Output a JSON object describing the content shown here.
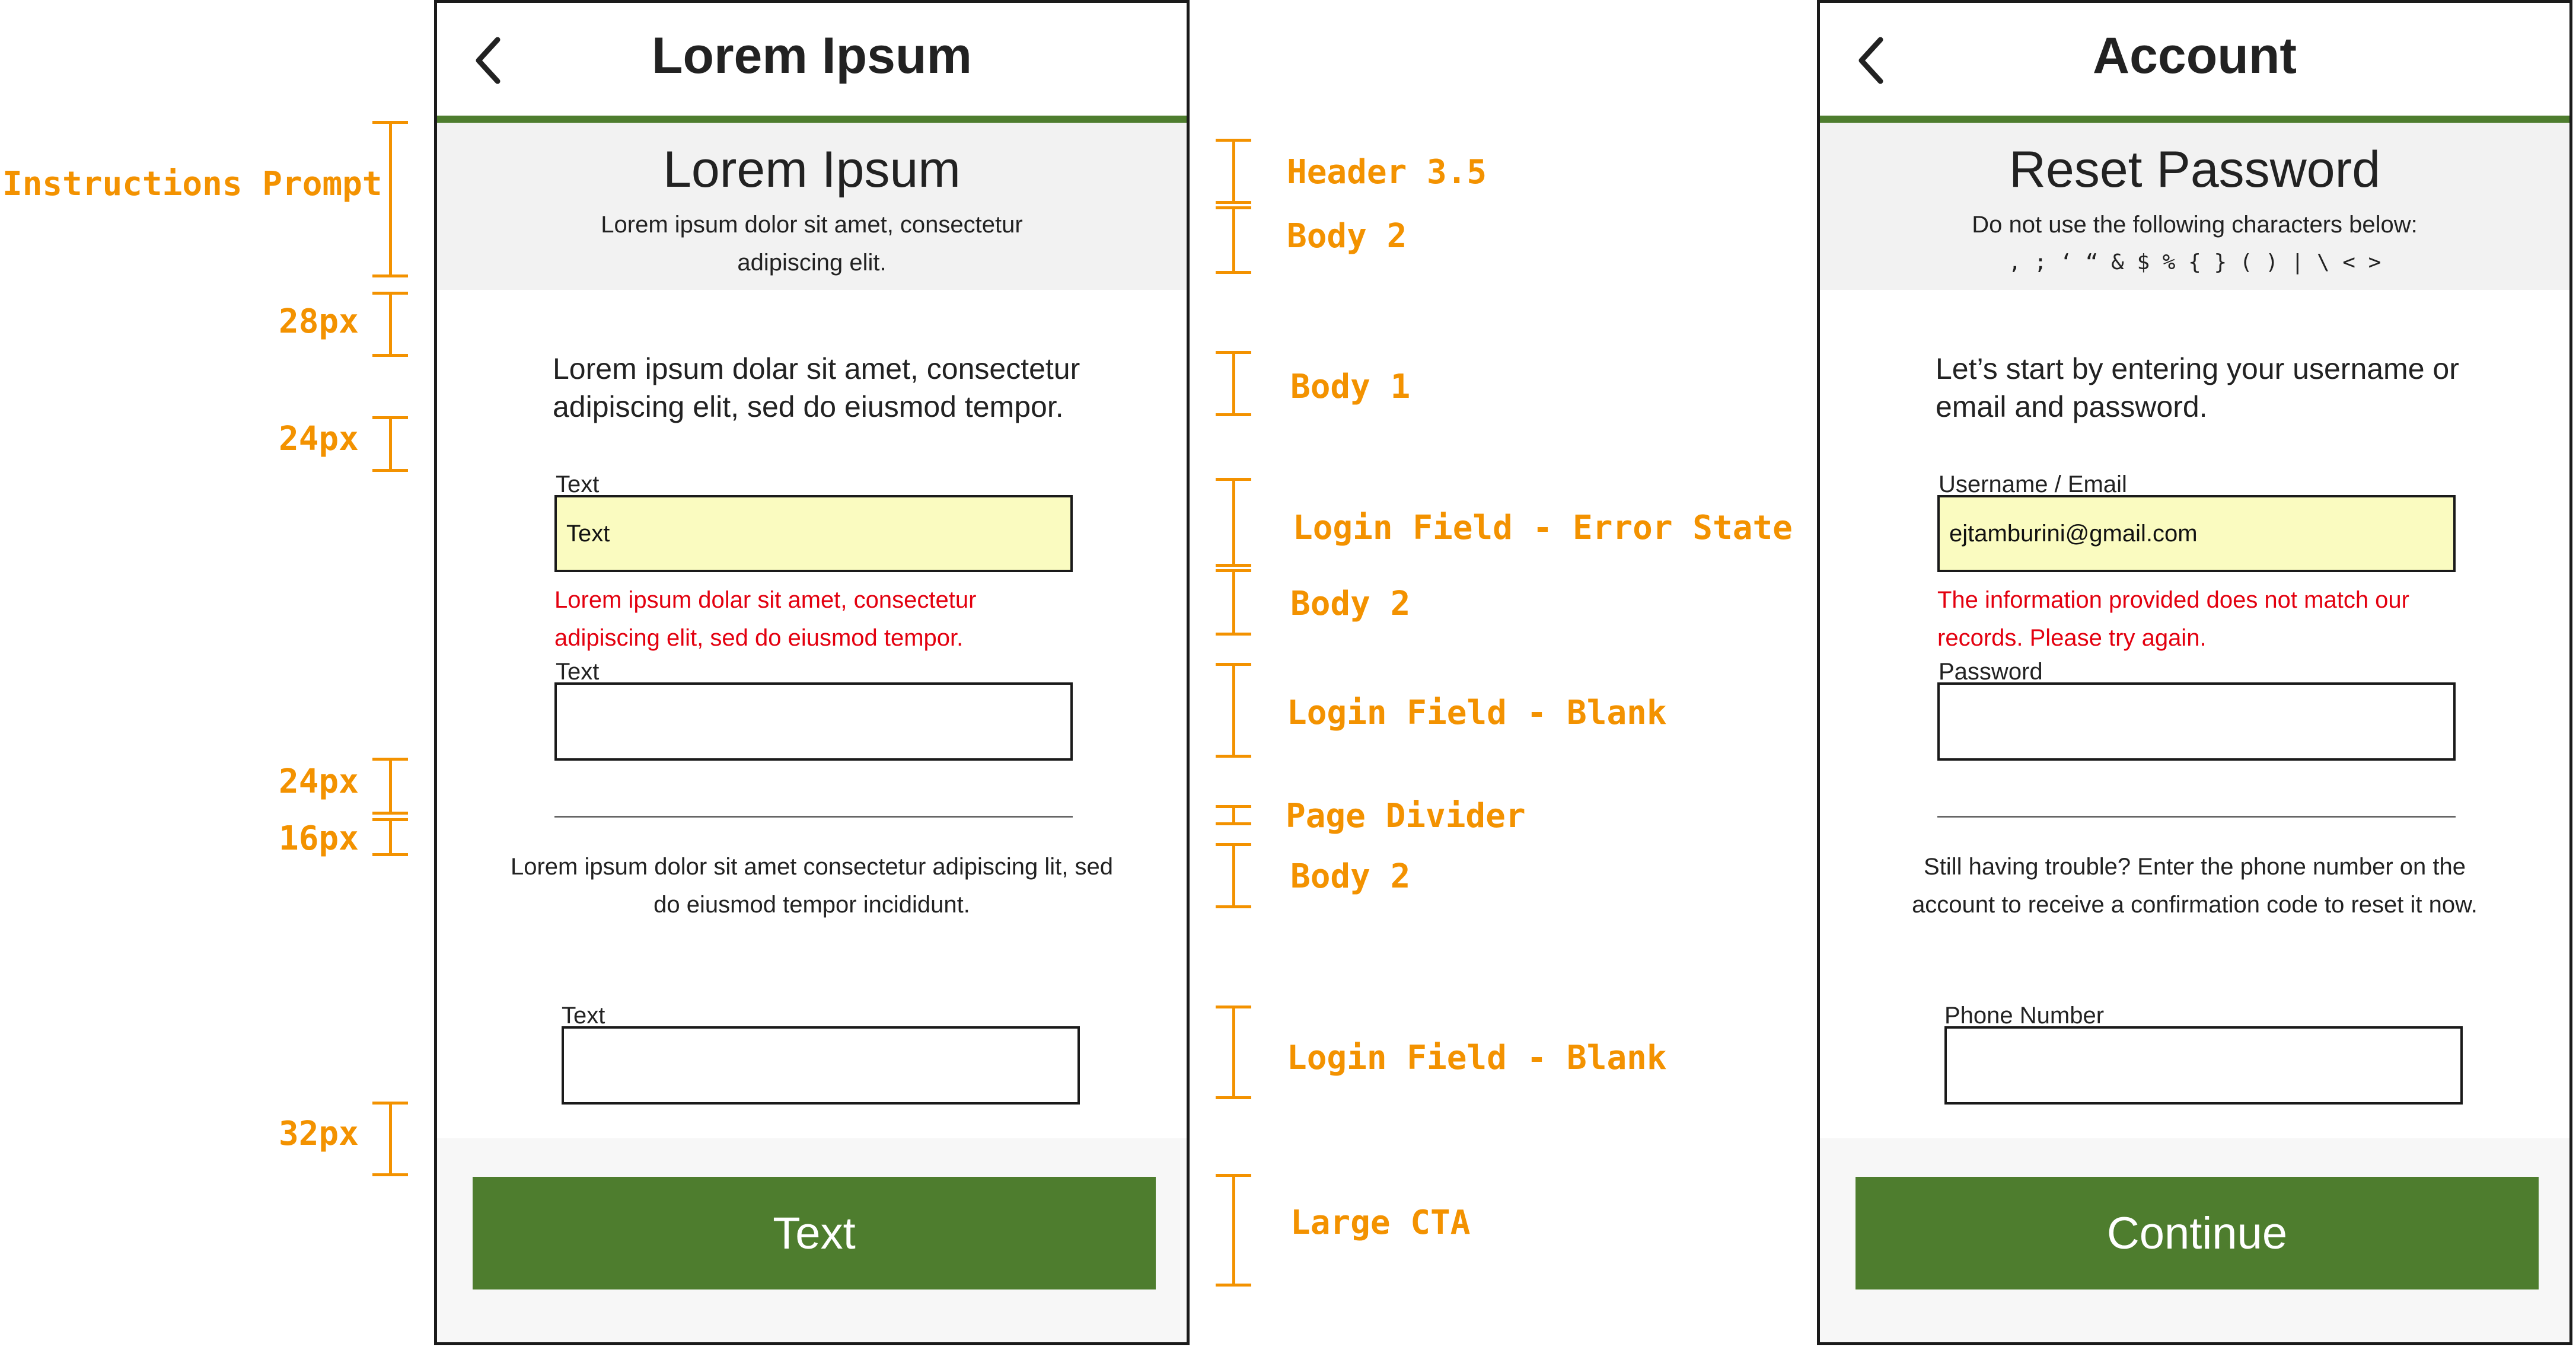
{
  "left_annotations": {
    "instructions_prompt": "Instructions Prompt",
    "spacing_28": "28px",
    "spacing_24a": "24px",
    "spacing_24b": "24px",
    "spacing_16": "16px",
    "spacing_32": "32px"
  },
  "middle_annotations": {
    "header_35": "Header 3.5",
    "body2_a": "Body 2",
    "body1": "Body 1",
    "login_error": "Login Field - Error State",
    "body2_b": "Body 2",
    "login_blank_a": "Login Field - Blank",
    "page_divider": "Page Divider",
    "body2_c": "Body 2",
    "login_blank_b": "Login Field - Blank",
    "large_cta": "Large CTA"
  },
  "template_screen": {
    "nav_title": "Lorem Ipsum",
    "prompt_header": "Lorem Ipsum",
    "prompt_body": "Lorem ipsum dolor sit amet, consectetur adipiscing elit.",
    "intro": "Lorem ipsum dolar sit amet, consectetur adipiscing elit, sed do eiusmod tempor.",
    "field1_label": "Text",
    "field1_value": "Text",
    "error_message": "Lorem ipsum dolar sit amet, consectetur adipiscing elit, sed do eiusmod tempor.",
    "field2_label": "Text",
    "field2_value": "",
    "body2_text": "Lorem ipsum dolor sit amet consectetur adipiscing lit, sed do eiusmod tempor incididunt.",
    "field3_label": "Text",
    "field3_value": "",
    "cta_label": "Text"
  },
  "account_screen": {
    "nav_title": "Account",
    "prompt_header": "Reset Password",
    "prompt_body_line1": "Do not use the following characters below:",
    "prompt_body_line2": ", ; ‘ “ & $ % { } ( ) | \\ < >",
    "intro": "Let’s start by entering your username or email and password.",
    "field1_label": "Username / Email",
    "field1_value": "ejtamburini@gmail.com",
    "error_message": "The information provided does not match our records. Please try again.",
    "field2_label": "Password",
    "field2_value": "",
    "body2_text": "Still having trouble? Enter the phone number on the account to receive a confirmation code to reset it now.",
    "field3_label": "Phone Number",
    "field3_value": "",
    "cta_label": "Continue"
  },
  "colors": {
    "accent_green": "#4E7D2E",
    "annotation_orange": "#F39200",
    "error_red": "#E3000F",
    "error_field_bg": "#FAFBC0",
    "prompt_bg": "#F2F2F2"
  }
}
